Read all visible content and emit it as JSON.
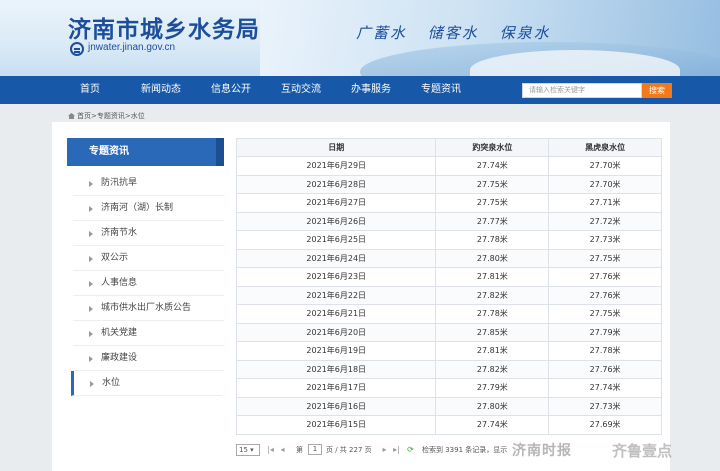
{
  "header": {
    "site_title": "济南市城乡水务局",
    "site_url": "jnwater.jinan.gov.cn",
    "slogan": [
      "广蓄水",
      "储客水",
      "保泉水"
    ]
  },
  "nav": {
    "items": [
      "首页",
      "新闻动态",
      "信息公开",
      "互动交流",
      "办事服务",
      "专题资讯"
    ],
    "search_placeholder": "请输入检索关键字",
    "search_button": "搜索"
  },
  "breadcrumb": "首页>专题资讯>水位",
  "sidebar": {
    "title": "专题资讯",
    "items": [
      "防汛抗旱",
      "济南河（湖）长制",
      "济南节水",
      "双公示",
      "人事信息",
      "城市供水出厂水质公告",
      "机关党建",
      "廉政建设",
      "水位"
    ],
    "active_index": 8
  },
  "table": {
    "headers": [
      "日期",
      "趵突泉水位",
      "黑虎泉水位"
    ],
    "rows": [
      [
        "2021年6月29日",
        "27.74米",
        "27.70米"
      ],
      [
        "2021年6月28日",
        "27.75米",
        "27.70米"
      ],
      [
        "2021年6月27日",
        "27.75米",
        "27.71米"
      ],
      [
        "2021年6月26日",
        "27.77米",
        "27.72米"
      ],
      [
        "2021年6月25日",
        "27.78米",
        "27.73米"
      ],
      [
        "2021年6月24日",
        "27.80米",
        "27.75米"
      ],
      [
        "2021年6月23日",
        "27.81米",
        "27.76米"
      ],
      [
        "2021年6月22日",
        "27.82米",
        "27.76米"
      ],
      [
        "2021年6月21日",
        "27.78米",
        "27.75米"
      ],
      [
        "2021年6月20日",
        "27.85米",
        "27.79米"
      ],
      [
        "2021年6月19日",
        "27.81米",
        "27.78米"
      ],
      [
        "2021年6月18日",
        "27.82米",
        "27.76米"
      ],
      [
        "2021年6月17日",
        "27.79米",
        "27.74米"
      ],
      [
        "2021年6月16日",
        "27.80米",
        "27.73米"
      ],
      [
        "2021年6月15日",
        "27.74米",
        "27.69米"
      ]
    ]
  },
  "pager": {
    "page_size": "15",
    "page_prefix": "第",
    "current_page": "1",
    "page_suffix": "页 / 共 227 页",
    "summary": "检索到 3391 条记录，显示"
  },
  "watermark": {
    "left": "济南时报",
    "right": "齐鲁壹点"
  },
  "colors": {
    "nav_bg": "#1758a8",
    "sidebar_head": "#2a69b8",
    "search_btn": "#f27a1a",
    "title_blue": "#1d4e9a"
  }
}
